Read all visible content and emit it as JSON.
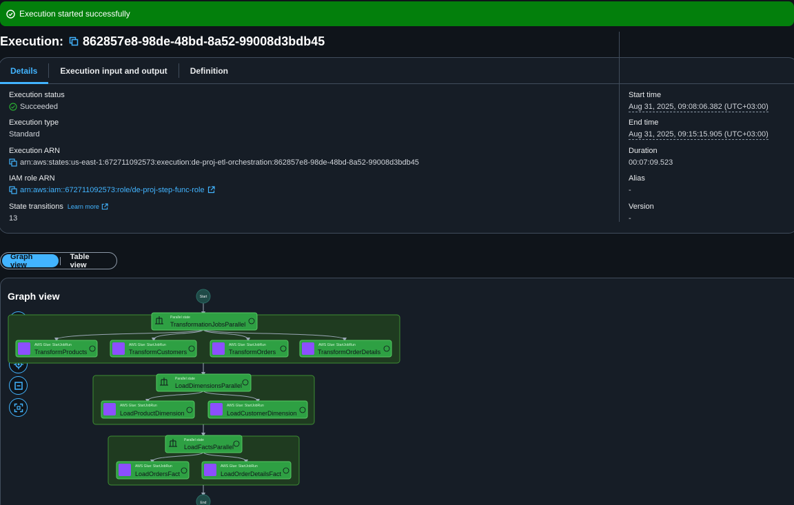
{
  "banner": {
    "message": "Execution started successfully"
  },
  "header": {
    "prefix": "Execution:",
    "id": "862857e8-98de-48bd-8a52-99008d3bdb45"
  },
  "tabs": [
    {
      "label": "Details"
    },
    {
      "label": "Execution input and output"
    },
    {
      "label": "Definition"
    }
  ],
  "details": {
    "status_label": "Execution status",
    "status_value": "Succeeded",
    "type_label": "Execution type",
    "type_value": "Standard",
    "arn_label": "Execution ARN",
    "arn_value": "arn:aws:states:us-east-1:672711092573:execution:de-proj-etl-orchestration:862857e8-98de-48bd-8a52-99008d3bdb45",
    "role_label": "IAM role ARN",
    "role_value": "arn:aws:iam::672711092573:role/de-proj-step-func-role",
    "transitions_label": "State transitions",
    "learn_more": "Learn more",
    "transitions_value": "13",
    "start_label": "Start time",
    "start_value": "Aug 31, 2025, 09:08:06.382 (UTC+03:00)",
    "end_label": "End time",
    "end_value": "Aug 31, 2025, 09:15:15.905 (UTC+03:00)",
    "duration_label": "Duration",
    "duration_value": "00:07:09.523",
    "alias_label": "Alias",
    "alias_value": "-",
    "version_label": "Version",
    "version_value": "-"
  },
  "view_toggle": {
    "graph": "Graph view",
    "table": "Table view"
  },
  "graph": {
    "title": "Graph view",
    "start": "Start",
    "end": "End",
    "parallel_type": "Parallel state",
    "task_type": "AWS Glue: StartJobRun",
    "parallel1": "TransformationJobsParallel",
    "tasks1": [
      "TransformProducts",
      "TransformCustomers",
      "TransformOrders",
      "TransformOrderDetails"
    ],
    "parallel2": "LoadDimensionsParallel",
    "tasks2": [
      "LoadProductDimension",
      "LoadCustomerDimension"
    ],
    "parallel3": "LoadFactsParallel",
    "tasks3": [
      "LoadOrdersFact",
      "LoadOrderDetailsFact"
    ],
    "zoom_controls": [
      "zoom-in-icon",
      "zoom-out-icon",
      "center-icon",
      "fit-icon",
      "fullscreen-icon"
    ]
  },
  "colors": {
    "success": "#037f0c",
    "accent": "#42b4ff",
    "node_green": "#2ea043",
    "glue_purple": "#8c4fff"
  }
}
